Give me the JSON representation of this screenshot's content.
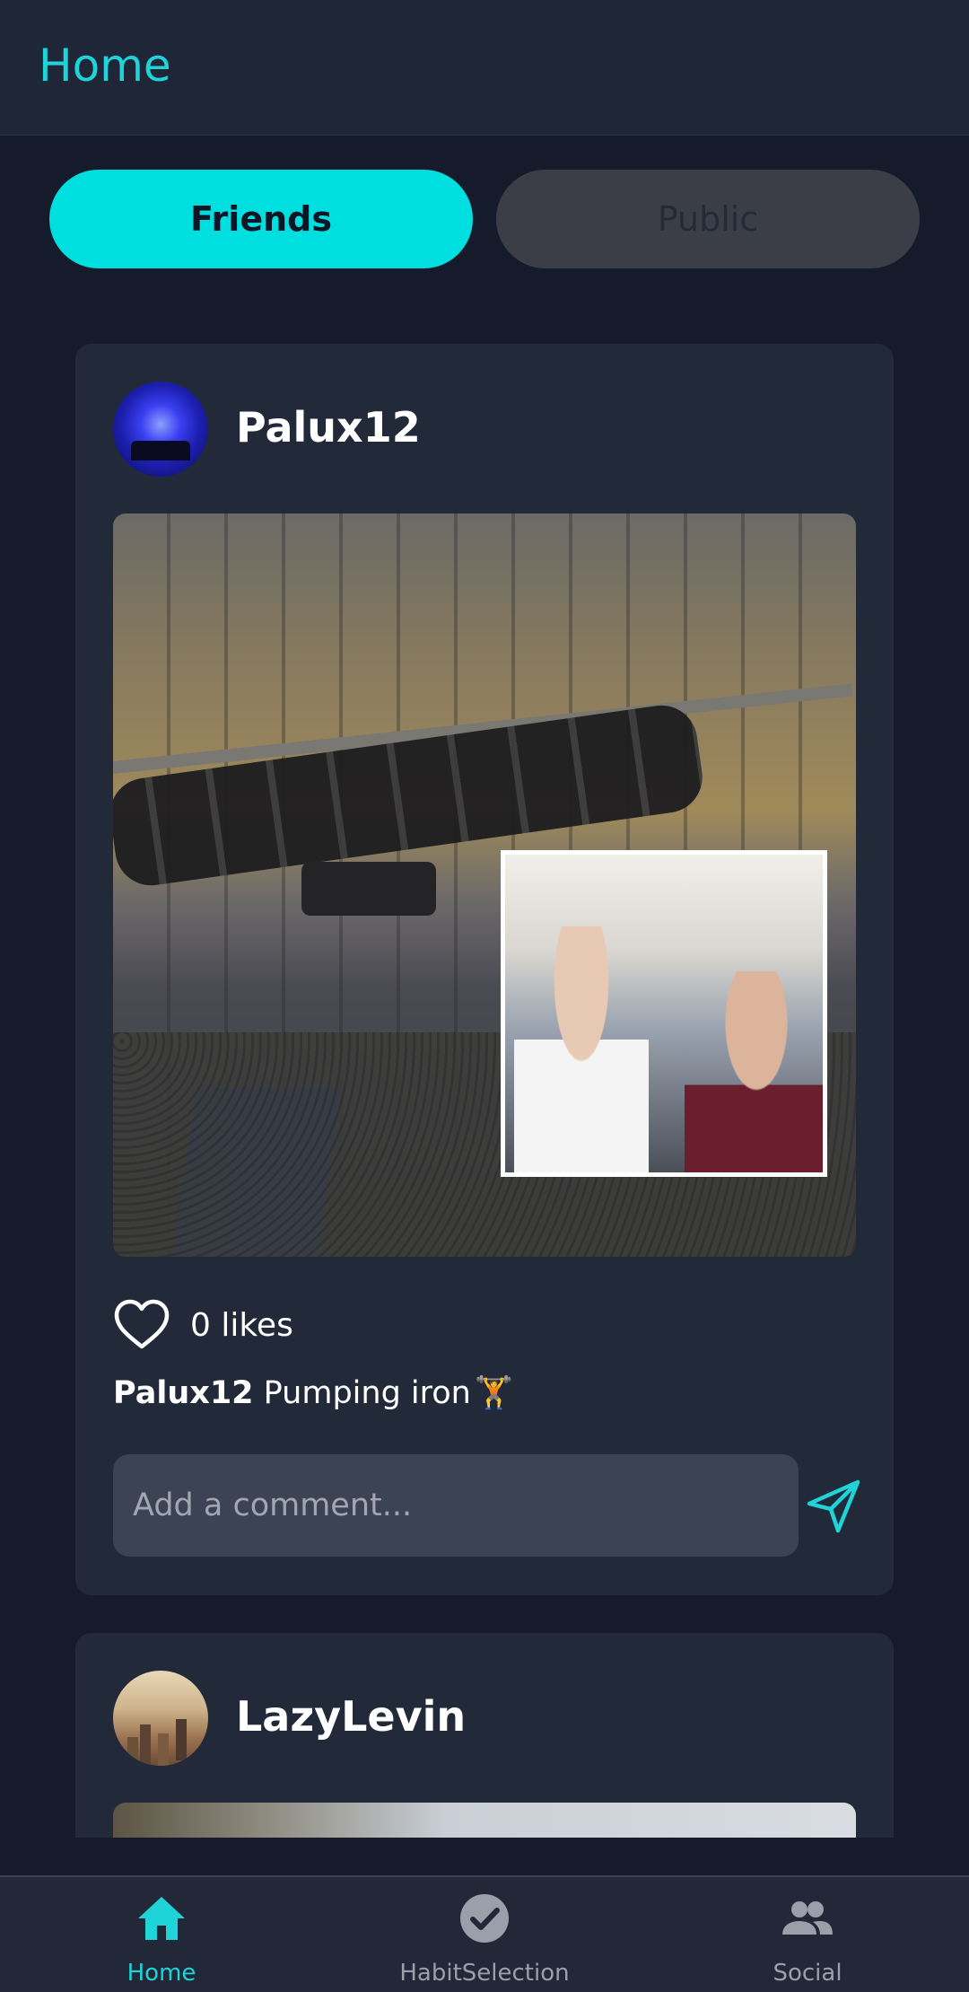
{
  "header": {
    "title": "Home"
  },
  "tabs": [
    {
      "label": "Friends",
      "active": true
    },
    {
      "label": "Public",
      "active": false
    }
  ],
  "posts": [
    {
      "username": "Palux12",
      "likes_text": "0 likes",
      "caption_user": "Palux12",
      "caption_text": "Pumping iron",
      "caption_emoji": "🏋",
      "comment_placeholder": "Add a comment..."
    },
    {
      "username": "LazyLevin"
    }
  ],
  "nav": {
    "items": [
      {
        "label": "Home",
        "icon": "home-icon",
        "active": true
      },
      {
        "label": "HabitSelection",
        "icon": "check-circle-icon",
        "active": false
      },
      {
        "label": "Social",
        "icon": "people-icon",
        "active": false
      }
    ]
  },
  "colors": {
    "accent": "#1fd4d8",
    "background": "#151b2b",
    "card": "#222a3a",
    "header": "#1f2637",
    "tab_active": "#00dfe0",
    "tab_inactive": "#3b3e46",
    "comment_field": "#3c4354",
    "nav_inactive": "#9aa0aa"
  }
}
